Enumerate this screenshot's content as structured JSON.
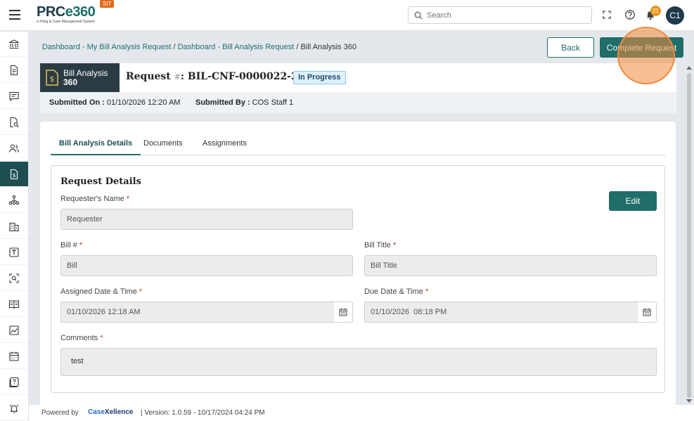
{
  "app": {
    "logo_text_1": "PRC",
    "logo_text_2": "e360",
    "logo_sub": "e-Filing & Case Management System",
    "env_badge": "SIT",
    "search_placeholder": "Search",
    "notification_count": "21",
    "avatar_initials": "C1"
  },
  "breadcrumb": {
    "link1": "Dashboard - My Bill Analysis Request",
    "sep1": " / ",
    "link2": "Dashboard - Bill Analysis Request",
    "sep2": " / ",
    "current": "Bill Analysis 360"
  },
  "actions": {
    "back_label": "Back",
    "complete_label": "Complete Request"
  },
  "header": {
    "tile_line1": "Bill Analysis",
    "tile_line2": "360",
    "request_prefix": "Request",
    "request_hash": "#",
    "request_id": ": BIL-CNF-0000022-26",
    "status": "In Progress",
    "submitted_on_label": "Submitted On :",
    "submitted_on_value": " 01/10/2026 12:20 AM",
    "submitted_by_label": "Submitted By :",
    "submitted_by_value": " COS Staff 1"
  },
  "tabs": [
    {
      "label": "Bill Analysis Details",
      "active": true
    },
    {
      "label": "Documents",
      "active": false
    },
    {
      "label": "Assignments",
      "active": false
    }
  ],
  "details": {
    "section_title": "Request Details",
    "edit_label": "Edit",
    "required_mark": "*",
    "requester_label": "Requester's Name",
    "requester_value": "Requester",
    "bill_no_label": "Bill #",
    "bill_no_value": "Bill",
    "bill_title_label": "Bill Title",
    "bill_title_value": "Bill Title",
    "assigned_label": "Assigned Date & Time",
    "assigned_value": "01/10/2026 12:18 AM",
    "due_label": "Due Date & Time",
    "due_value": "01/10/2026  08:18 PM",
    "comments_label": "Comments",
    "comments_value": "test"
  },
  "footer": {
    "powered_by": "Powered by",
    "brand_1": "Case",
    "brand_2": "Xellence",
    "version": "|   Version: 1.0.59 - 10/17/2024 04:24 PM"
  },
  "sidebar_icons": [
    "institution-icon",
    "document-icon",
    "chat-icon",
    "search-document-icon",
    "users-icon",
    "bill-dollar-icon",
    "org-tree-icon",
    "building-icon",
    "text-box-icon",
    "scan-search-icon",
    "book-icon",
    "chart-icon",
    "calendar-icon",
    "help-book-icon",
    "bell-ring-icon"
  ],
  "colors": {
    "primary": "#1f6e6a",
    "sidebar_active": "#1f4e52",
    "tile_bg": "#2a3b43",
    "badge": "#e8961e",
    "env_badge": "#e06a1b"
  }
}
